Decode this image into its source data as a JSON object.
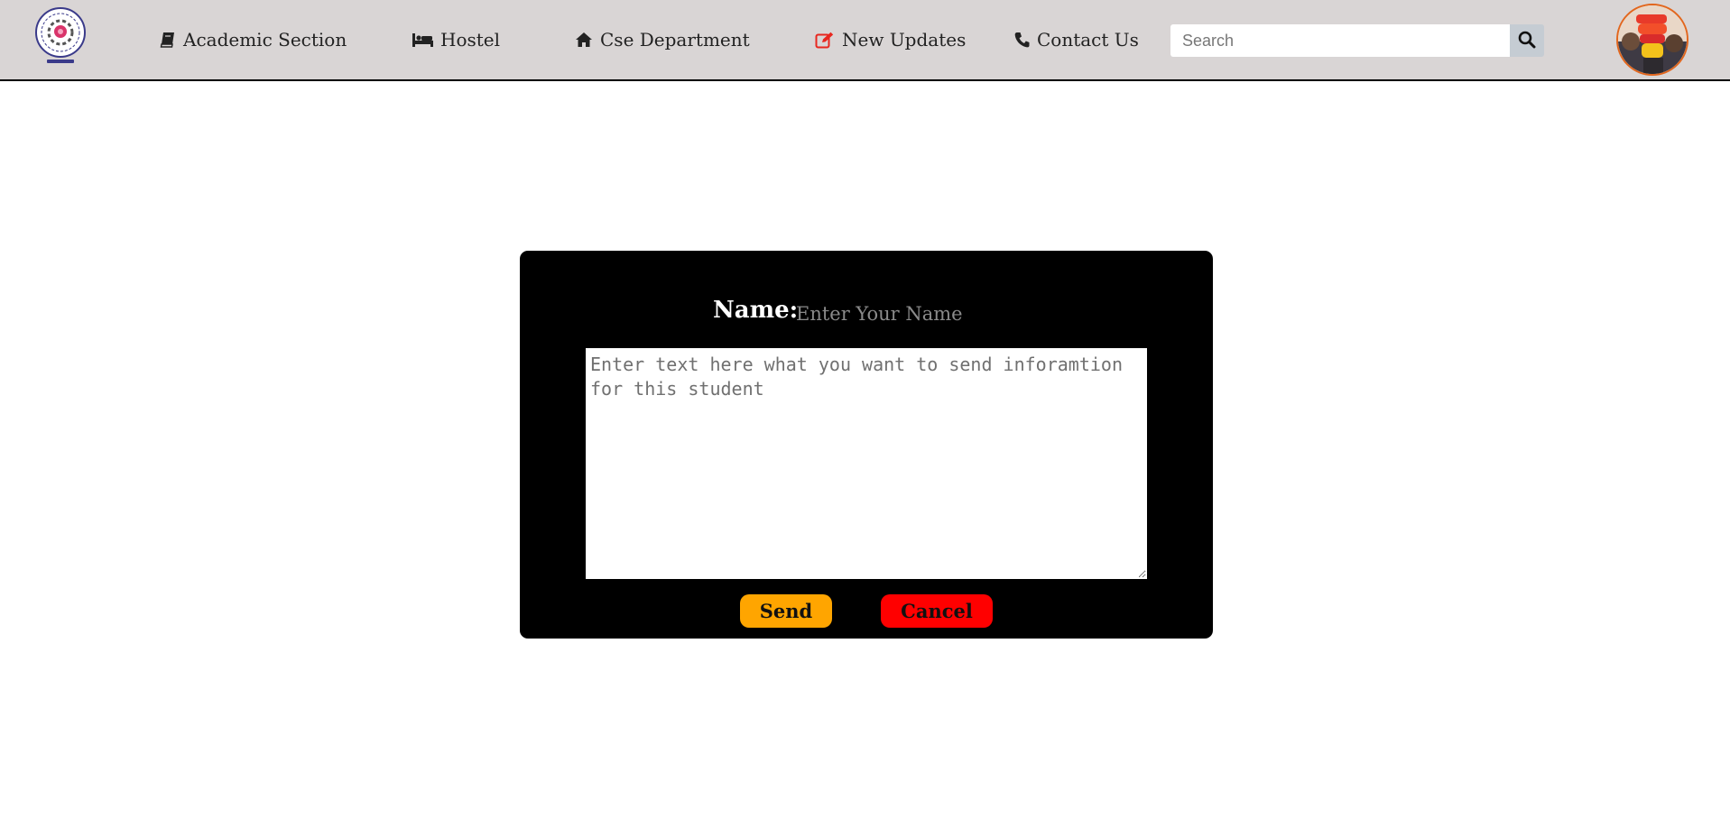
{
  "navbar": {
    "logo": "university-logo",
    "links": [
      {
        "label": "Academic Section",
        "icon": "book-icon"
      },
      {
        "label": "Hostel",
        "icon": "bed-icon"
      },
      {
        "label": "Cse Department",
        "icon": "home-icon"
      },
      {
        "label": "New Updates",
        "icon": "edit-icon"
      },
      {
        "label": "Contact Us",
        "icon": "phone-icon"
      }
    ],
    "search": {
      "placeholder": "Search",
      "value": "",
      "icon": "search-icon"
    },
    "avatar": "profile-avatar"
  },
  "form": {
    "name_label": "Name:",
    "name_placeholder": "Enter Your Name",
    "message_placeholder": "Enter text here what you want to send inforamtion for this student",
    "send_label": "Send",
    "cancel_label": "Cancel"
  },
  "colors": {
    "navbar_bg": "#d9d5d5",
    "panel_bg": "#000000",
    "send_button": "#ffa500",
    "cancel_button": "#ff0000",
    "updates_icon": "#e8271f",
    "avatar_border": "#e2661d"
  }
}
